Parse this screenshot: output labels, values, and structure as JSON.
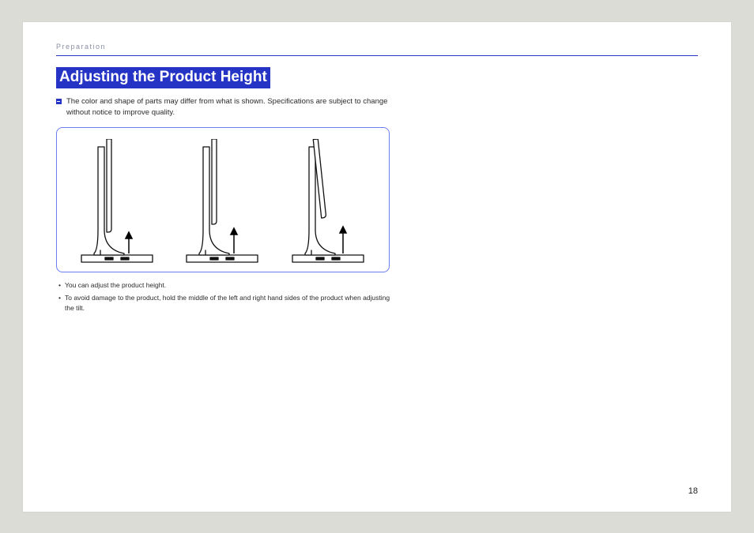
{
  "header": {
    "breadcrumb": "Preparation"
  },
  "title": "Adjusting the Product Height",
  "note": "The color and shape of parts may differ from what is shown. Specifications are subject to change without notice to improve quality.",
  "bullets": [
    "You can adjust the product height.",
    "To avoid damage to the product, hold the middle of the left and right hand sides of the product when adjusting the tilt."
  ],
  "page_number": "18"
}
